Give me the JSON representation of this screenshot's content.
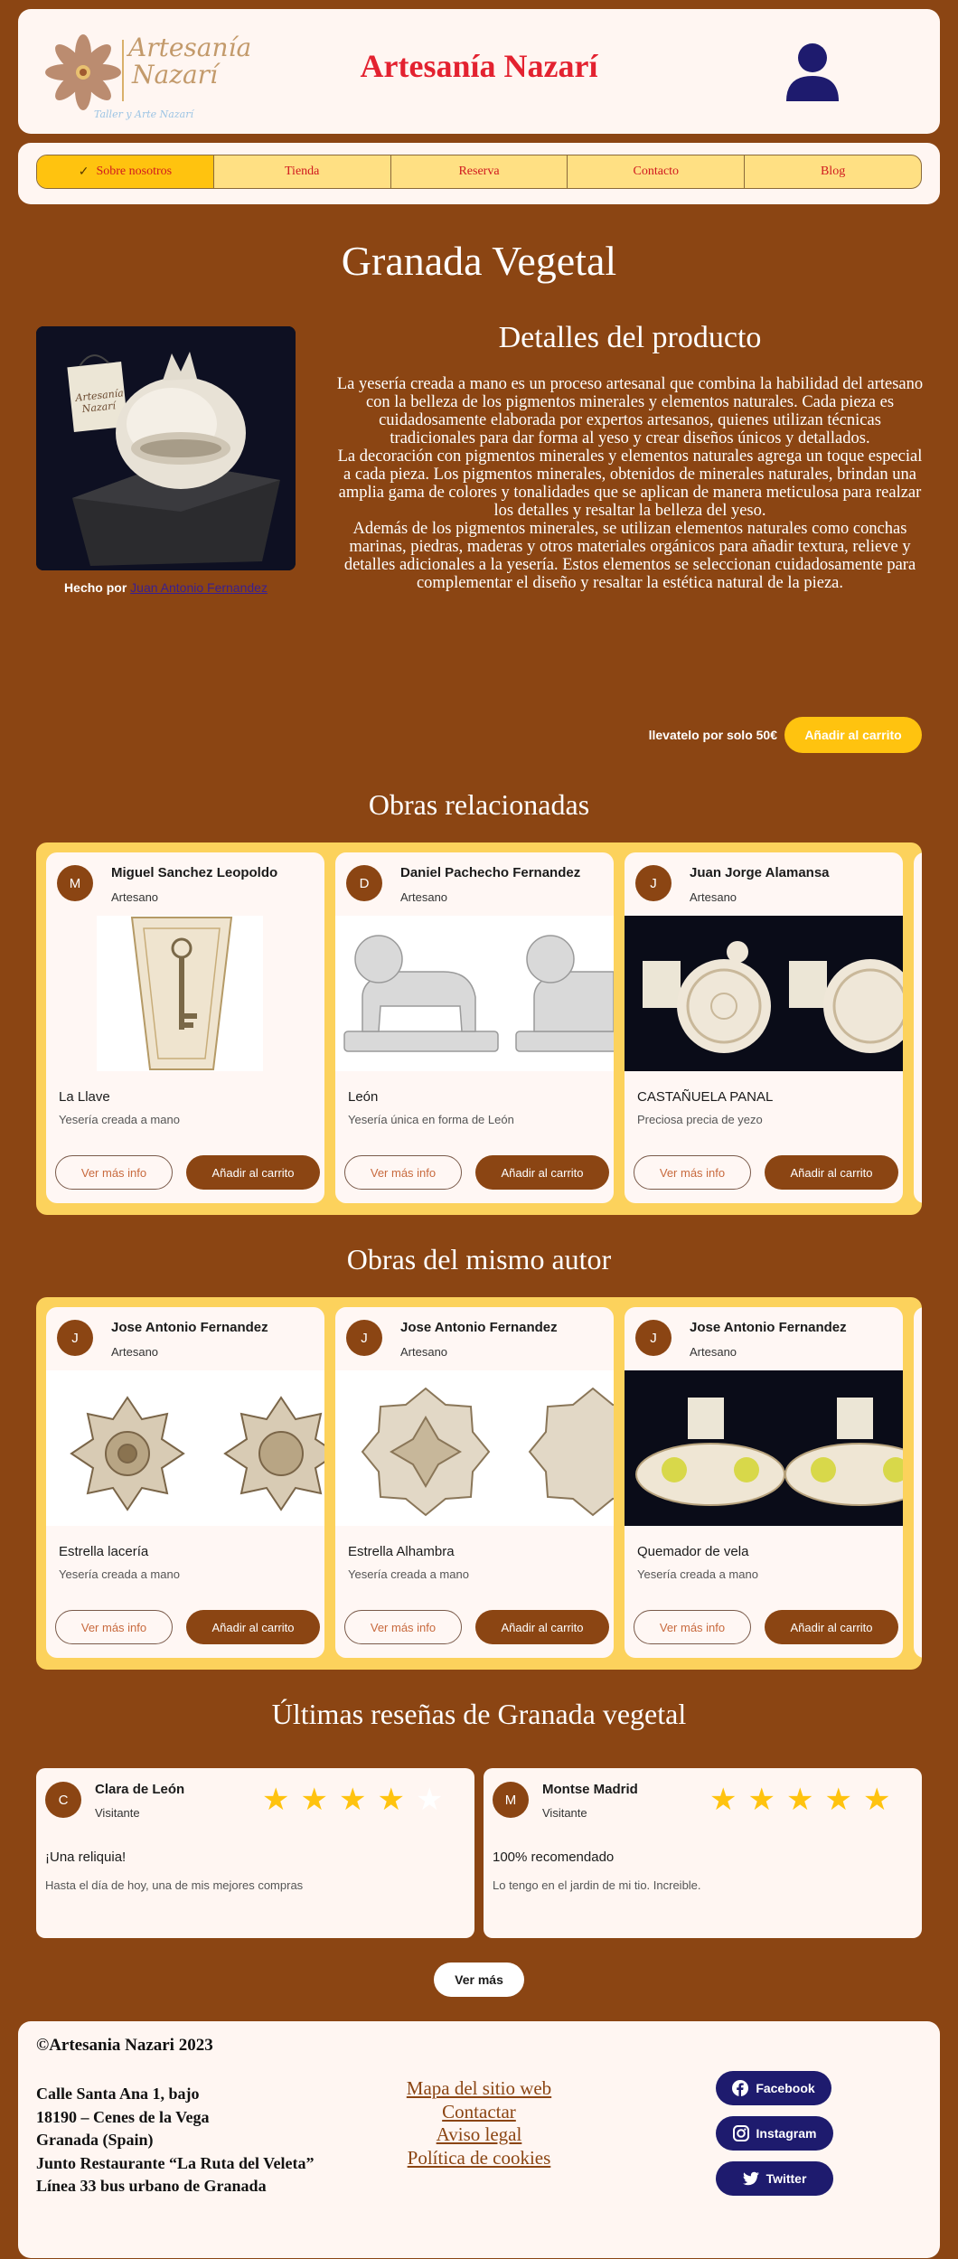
{
  "header": {
    "logo_line1": "Artesanía",
    "logo_line2": "Nazarí",
    "logo_tagline": "Taller y Arte Nazarí",
    "site_title": "Artesanía Nazarí"
  },
  "nav": {
    "items": [
      {
        "label": "Sobre nosotros",
        "active": true
      },
      {
        "label": "Tienda"
      },
      {
        "label": "Reserva"
      },
      {
        "label": "Contacto"
      },
      {
        "label": "Blog"
      }
    ]
  },
  "product": {
    "title": "Granada Vegetal",
    "image_label_line1": "Artesanía",
    "image_label_line2": "Nazarí",
    "made_by_prefix": "Hecho por",
    "author_link": "Juan Antonio Fernandez",
    "details_title": "Detalles del producto",
    "details_text": "La yesería creada a mano es un proceso artesanal que combina la habilidad del artesano con la belleza de los pigmentos minerales y elementos naturales. Cada pieza es cuidadosamente elaborada por expertos artesanos, quienes utilizan técnicas tradicionales para dar forma al yeso y crear diseños únicos y detallados.\nLa decoración con pigmentos minerales y elementos naturales agrega un toque especial a cada pieza. Los pigmentos minerales, obtenidos de minerales naturales, brindan una amplia gama de colores y tonalidades que se aplican de manera meticulosa para realzar los detalles y resaltar la belleza del yeso.\nAdemás de los pigmentos minerales, se utilizan elementos naturales como conchas marinas, piedras, maderas y otros materiales orgánicos para añadir textura, relieve y detalles adicionales a la yesería. Estos elementos se seleccionan cuidadosamente para complementar el diseño y resaltar la estética natural de la pieza.",
    "price_text": "llevatelo por solo 50€",
    "cart_label": "Añadir al carrito"
  },
  "related": {
    "title": "Obras relacionadas",
    "cards": [
      {
        "initial": "M",
        "author": "Miguel Sanchez Leopoldo",
        "role": "Artesano",
        "title": "La Llave",
        "subtitle": "Yesería creada a mano",
        "info_label": "Ver más info",
        "cart_label": "Añadir al carrito"
      },
      {
        "initial": "D",
        "author": "Daniel Pachecho Fernandez",
        "role": "Artesano",
        "title": "León",
        "subtitle": "Yesería única en forma de León",
        "info_label": "Ver más info",
        "cart_label": "Añadir al carrito"
      },
      {
        "initial": "J",
        "author": "Juan Jorge Alamansa",
        "role": "Artesano",
        "title": "CASTAÑUELA PANAL",
        "subtitle": "Preciosa precia de yezo",
        "info_label": "Ver más info",
        "cart_label": "Añadir al carrito"
      }
    ]
  },
  "same_author": {
    "title": "Obras del mismo autor",
    "cards": [
      {
        "initial": "J",
        "author": "Jose Antonio Fernandez",
        "role": "Artesano",
        "title": "Estrella lacería",
        "subtitle": "Yesería creada a mano",
        "info_label": "Ver más info",
        "cart_label": "Añadir al carrito"
      },
      {
        "initial": "J",
        "author": "Jose Antonio Fernandez",
        "role": "Artesano",
        "title": "Estrella Alhambra",
        "subtitle": "Yesería creada a mano",
        "info_label": "Ver más info",
        "cart_label": "Añadir al carrito"
      },
      {
        "initial": "J",
        "author": "Jose Antonio Fernandez",
        "role": "Artesano",
        "title": "Quemador de vela",
        "subtitle": "Yesería creada a mano",
        "info_label": "Ver más info",
        "cart_label": "Añadir al carrito"
      }
    ]
  },
  "reviews": {
    "title": "Últimas reseñas de Granada vegetal",
    "items": [
      {
        "initial": "C",
        "name": "Clara de León",
        "role": "Visitante",
        "rating": 4,
        "max_rating": 5,
        "title": "¡Una reliquia!",
        "text": "Hasta el día de hoy, una de mis mejores compras"
      },
      {
        "initial": "M",
        "name": "Montse Madrid",
        "role": "Visitante",
        "rating": 5,
        "max_rating": 5,
        "title": "100% recomendado",
        "text": "Lo tengo en el jardin de mi tio. Increible."
      }
    ],
    "more_label": "Ver más"
  },
  "footer": {
    "copyright": "©Artesania Nazari 2023",
    "address": [
      "Calle Santa Ana 1, bajo",
      "18190 – Cenes de la Vega",
      "Granada (Spain)",
      "Junto Restaurante “La Ruta del Veleta”",
      "Línea 33 bus urbano de Granada"
    ],
    "links": [
      "Mapa del sitio web",
      "Contactar",
      "Aviso legal",
      "Política de cookies"
    ],
    "social": [
      {
        "label": "Facebook",
        "icon": "facebook-icon"
      },
      {
        "label": "Instagram",
        "icon": "instagram-icon"
      },
      {
        "label": "Twitter",
        "icon": "twitter-icon"
      }
    ]
  },
  "colors": {
    "background": "#8B4513",
    "panel": "#FFF6F2",
    "title_red": "#E32230",
    "accent_yellow": "#FFC30F",
    "carousel_bg": "#FCD25C",
    "star": "#FFC30F",
    "social_bg": "#1E1B6E"
  }
}
